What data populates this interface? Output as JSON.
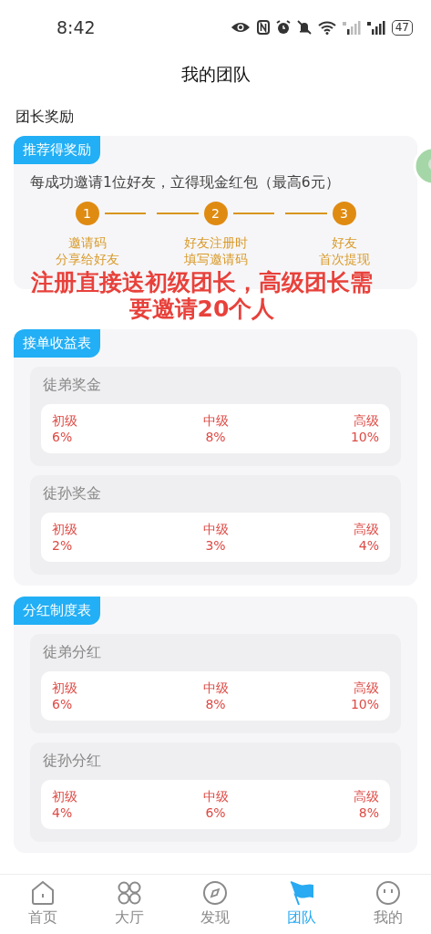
{
  "status_bar": {
    "time": "8:42",
    "battery": "47"
  },
  "header": {
    "title": "我的团队"
  },
  "section_title": "团长奖励",
  "referral": {
    "tag": "推荐得奖励",
    "description": "每成功邀请1位好友，立得现金红包（最高6元）",
    "steps": [
      {
        "number": "1",
        "lines": [
          "邀请码",
          "分享给好友"
        ]
      },
      {
        "number": "2",
        "lines": [
          "好友注册时",
          "填写邀请码"
        ]
      },
      {
        "number": "3",
        "lines": [
          "好友",
          "首次提现"
        ]
      }
    ]
  },
  "overlay_note": "注册直接送初级团长，高级团长需要邀请20个人",
  "tables": [
    {
      "tag": "接单收益表",
      "groups": [
        {
          "title": "徒弟奖金",
          "levels": [
            {
              "name": "初级",
              "value": "6%"
            },
            {
              "name": "中级",
              "value": "8%"
            },
            {
              "name": "高级",
              "value": "10%"
            }
          ]
        },
        {
          "title": "徒孙奖金",
          "levels": [
            {
              "name": "初级",
              "value": "2%"
            },
            {
              "name": "中级",
              "value": "3%"
            },
            {
              "name": "高级",
              "value": "4%"
            }
          ]
        }
      ]
    },
    {
      "tag": "分红制度表",
      "groups": [
        {
          "title": "徒弟分红",
          "levels": [
            {
              "name": "初级",
              "value": "6%"
            },
            {
              "name": "中级",
              "value": "8%"
            },
            {
              "name": "高级",
              "value": "10%"
            }
          ]
        },
        {
          "title": "徒孙分红",
          "levels": [
            {
              "name": "初级",
              "value": "4%"
            },
            {
              "name": "中级",
              "value": "6%"
            },
            {
              "name": "高级",
              "value": "8%"
            }
          ]
        }
      ]
    }
  ],
  "tab_bar": [
    {
      "label": "首页",
      "kind": "home",
      "selected": false
    },
    {
      "label": "大厅",
      "kind": "grid",
      "selected": false
    },
    {
      "label": "发现",
      "kind": "compass",
      "selected": false
    },
    {
      "label": "团队",
      "kind": "flag",
      "selected": true
    },
    {
      "label": "我的",
      "kind": "face",
      "selected": false
    }
  ]
}
